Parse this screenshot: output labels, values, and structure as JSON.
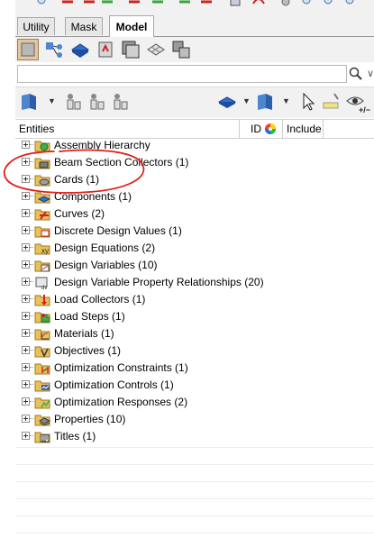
{
  "tabs": [
    {
      "label": "Utility",
      "active": false
    },
    {
      "label": "Mask",
      "active": false
    },
    {
      "label": "Model",
      "active": true
    }
  ],
  "search": {
    "value": "",
    "placeholder": ""
  },
  "toolbar2": {
    "pm_label": "+/−"
  },
  "header": {
    "entities": "Entities",
    "id": "ID",
    "include": "Include"
  },
  "tree": [
    {
      "label": "Assembly Hierarchy",
      "icon": "assembly-icon"
    },
    {
      "label": "Beam Section Collectors (1)",
      "icon": "beam-section-icon"
    },
    {
      "label": "Cards (1)",
      "icon": "cards-icon"
    },
    {
      "label": "Components (1)",
      "icon": "components-icon"
    },
    {
      "label": "Curves (2)",
      "icon": "curves-icon"
    },
    {
      "label": "Discrete Design Values (1)",
      "icon": "discrete-design-values-icon"
    },
    {
      "label": "Design Equations (2)",
      "icon": "design-equations-icon"
    },
    {
      "label": "Design Variables (10)",
      "icon": "design-variables-icon"
    },
    {
      "label": "Design Variable Property Relationships (20)",
      "icon": "dvprel-icon"
    },
    {
      "label": "Load Collectors (1)",
      "icon": "load-collectors-icon"
    },
    {
      "label": "Load Steps (1)",
      "icon": "load-steps-icon"
    },
    {
      "label": "Materials (1)",
      "icon": "materials-icon"
    },
    {
      "label": "Objectives (1)",
      "icon": "objectives-icon"
    },
    {
      "label": "Optimization Constraints (1)",
      "icon": "optimization-constraints-icon"
    },
    {
      "label": "Optimization Controls (1)",
      "icon": "optimization-controls-icon"
    },
    {
      "label": "Optimization Responses (2)",
      "icon": "optimization-responses-icon"
    },
    {
      "label": "Properties (10)",
      "icon": "properties-icon"
    },
    {
      "label": "Titles (1)",
      "icon": "titles-icon"
    }
  ],
  "colors": {
    "annotation": "#e0201a",
    "selected_tool": "#e2c79e",
    "folder": "#e9c05a"
  }
}
